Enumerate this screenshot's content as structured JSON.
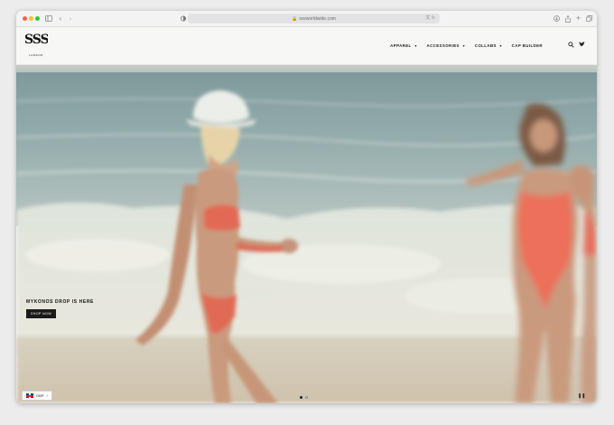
{
  "browser": {
    "url": "sssworldwide.com",
    "back_icon": "chevron-left-icon",
    "forward_icon": "chevron-right-icon",
    "sidebar_icon": "sidebar-icon",
    "shield_icon": "privacy-shield-icon",
    "lock_icon": "lock-icon",
    "translate_icon": "translate-icon",
    "download_icon": "download-icon",
    "share_icon": "share-icon",
    "newtab_icon": "plus-icon",
    "tabs_icon": "tab-overview-icon"
  },
  "header": {
    "logo_text": "SSS",
    "logo_sub": "LONDON",
    "nav": [
      {
        "label": "APPAREL",
        "has_menu": true
      },
      {
        "label": "ACCESSORIES",
        "has_menu": true
      },
      {
        "label": "COLLABS",
        "has_menu": true
      },
      {
        "label": "CAP BUILDER",
        "has_menu": false
      }
    ],
    "search_icon": "search-icon",
    "twitter_icon": "twitter-icon"
  },
  "hero": {
    "title": "MYKONOS DROP IS HERE",
    "button": "SHOP NOW",
    "slide_count": 2,
    "active_slide": 1
  },
  "currency": {
    "code": "GBP",
    "flag": "uk-flag-icon"
  },
  "colors": {
    "header_bg": "#f7f7f5",
    "button_bg": "#1a1a1a",
    "sea": "#8fa6a8",
    "sand": "#d9cab4"
  }
}
